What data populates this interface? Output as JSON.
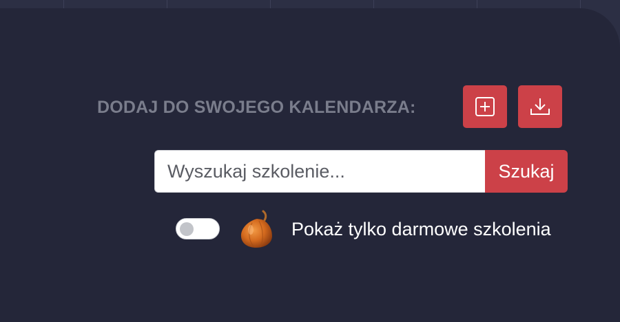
{
  "calendar": {
    "label": "DODAJ DO SWOJEGO KALENDARZA:",
    "add_button_icon": "plus-square-icon",
    "download_button_icon": "download-icon"
  },
  "search": {
    "placeholder": "Wyszukaj szkolenie...",
    "value": "",
    "button_label": "Szukaj"
  },
  "filter": {
    "toggle_on": false,
    "icon": "onion-icon",
    "label": "Pokaż tylko darmowe szkolenia"
  },
  "colors": {
    "background": "#242639",
    "accent": "#cc4148",
    "muted_label": "#7a7d8c"
  }
}
